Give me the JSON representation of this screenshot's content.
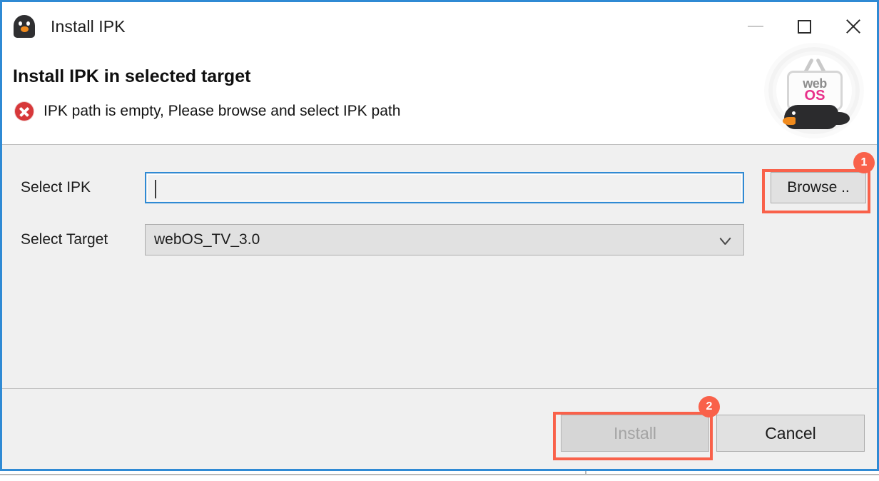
{
  "window": {
    "title": "Install IPK",
    "title_icon": "penguin-icon",
    "controls": {
      "minimize": "minimize-icon",
      "maximize": "maximize-icon",
      "close": "close-icon"
    }
  },
  "banner": {
    "heading": "Install IPK in selected target",
    "status_icon": "error-icon",
    "status_message": "IPK path is empty, Please browse and select IPK path",
    "logo": {
      "word_top": "web",
      "word_bottom": "OS",
      "icon": "webos-tv-penguin-logo"
    }
  },
  "form": {
    "ipk": {
      "label": "Select IPK",
      "value": "",
      "placeholder": ""
    },
    "target": {
      "label": "Select Target",
      "value": "webOS_TV_3.0",
      "options": [
        "webOS_TV_3.0"
      ],
      "arrow_icon": "chevron-down-icon"
    },
    "browse_label": "Browse .."
  },
  "footer": {
    "install_label": "Install",
    "cancel_label": "Cancel"
  },
  "annotations": {
    "badge_one": "1",
    "badge_two": "2",
    "highlight_color": "#f9614a"
  }
}
